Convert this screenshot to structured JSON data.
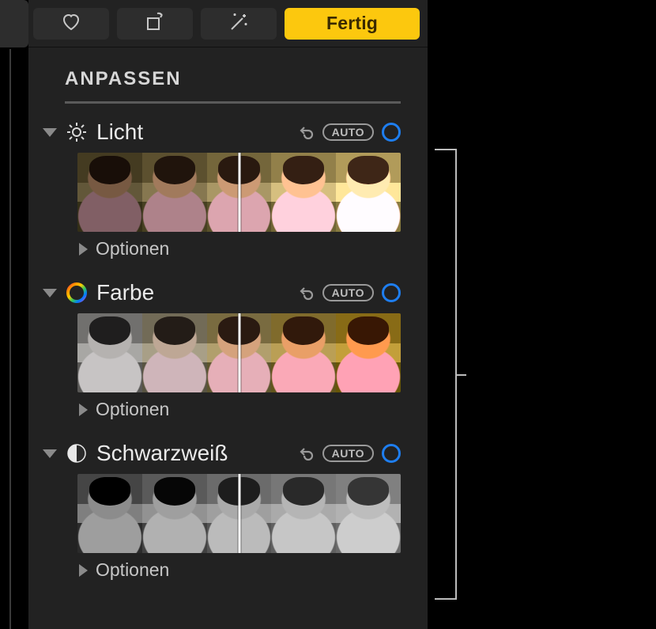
{
  "toolbar": {
    "done_label": "Fertig"
  },
  "section_title": "ANPASSEN",
  "auto_label": "AUTO",
  "options_label": "Optionen",
  "groups": {
    "light": {
      "label": "Licht",
      "icon": "light-icon"
    },
    "color": {
      "label": "Farbe",
      "icon": "color-icon"
    },
    "bw": {
      "label": "Schwarzweiß",
      "icon": "bw-icon"
    }
  },
  "colors": {
    "accent": "#1e7ef0",
    "done_bg": "#fcc80e"
  }
}
